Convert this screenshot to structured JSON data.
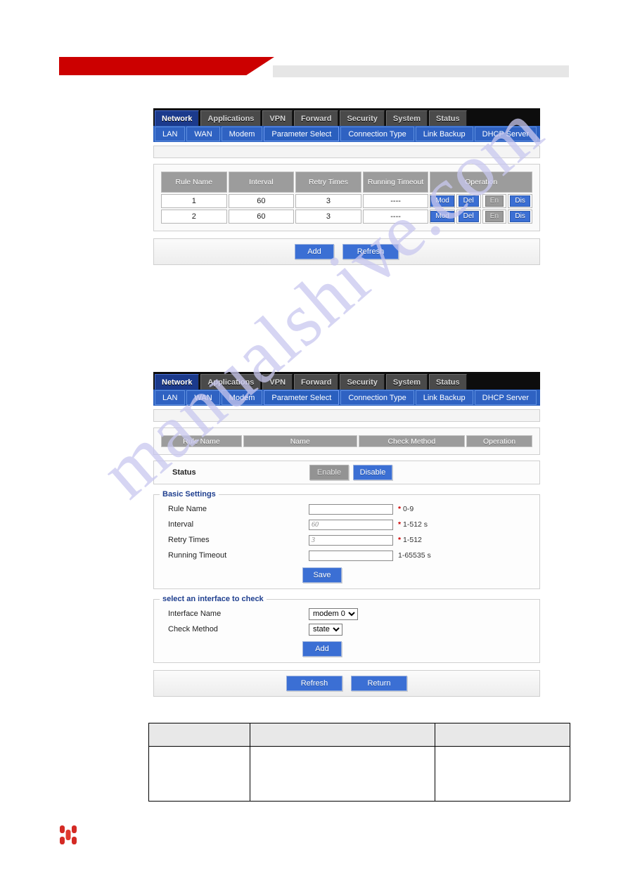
{
  "watermark": {
    "text": "manualshive.com"
  },
  "nav": {
    "main_tabs": [
      {
        "label": "Network",
        "active": true
      },
      {
        "label": "Applications",
        "active": false
      },
      {
        "label": "VPN",
        "active": false
      },
      {
        "label": "Forward",
        "active": false
      },
      {
        "label": "Security",
        "active": false
      },
      {
        "label": "System",
        "active": false
      },
      {
        "label": "Status",
        "active": false
      }
    ],
    "sub_tabs": [
      {
        "label": "LAN",
        "active": false
      },
      {
        "label": "WAN",
        "active": false
      },
      {
        "label": "Modem",
        "active": false
      },
      {
        "label": "Parameter Select",
        "active": true
      },
      {
        "label": "Connection Type",
        "active": false
      },
      {
        "label": "Link Backup",
        "active": false
      },
      {
        "label": "DHCP Server",
        "active": false
      }
    ]
  },
  "panel1": {
    "table": {
      "columns": [
        "Rule Name",
        "Interval",
        "Retry Times",
        "Running Timeout",
        "Operation"
      ],
      "rows": [
        {
          "rule_name": "1",
          "interval": "60",
          "retry_times": "3",
          "running_timeout": "----",
          "operations": [
            {
              "label": "Mod",
              "enabled": true
            },
            {
              "label": "Del",
              "enabled": true
            },
            {
              "label": "En",
              "enabled": false
            },
            {
              "label": "Dis",
              "enabled": true
            }
          ]
        },
        {
          "rule_name": "2",
          "interval": "60",
          "retry_times": "3",
          "running_timeout": "----",
          "operations": [
            {
              "label": "Mod",
              "enabled": true
            },
            {
              "label": "Del",
              "enabled": true
            },
            {
              "label": "En",
              "enabled": false
            },
            {
              "label": "Dis",
              "enabled": true
            }
          ]
        }
      ]
    },
    "buttons": {
      "add": "Add",
      "refresh": "Refresh"
    }
  },
  "panel2": {
    "table": {
      "columns": [
        "Rule Name",
        "Name",
        "Check Method",
        "Operation"
      ]
    },
    "status": {
      "label": "Status",
      "enable": "Enable",
      "disable": "Disable",
      "enable_active": false,
      "disable_active": true
    },
    "basic_settings": {
      "legend": "Basic Settings",
      "fields": [
        {
          "label": "Rule Name",
          "value": "",
          "required": true,
          "hint": "0-9"
        },
        {
          "label": "Interval",
          "value": "60",
          "required": true,
          "hint": "1-512 s"
        },
        {
          "label": "Retry Times",
          "value": "3",
          "required": true,
          "hint": "1-512"
        },
        {
          "label": "Running Timeout",
          "value": "",
          "required": false,
          "hint": "1-65535 s"
        }
      ],
      "save": "Save"
    },
    "interface_check": {
      "legend": "select an interface to check",
      "interface_name_label": "Interface Name",
      "interface_name_value": "modem 0",
      "interface_name_options": [
        "modem 0"
      ],
      "check_method_label": "Check Method",
      "check_method_value": "state",
      "check_method_options": [
        "state"
      ],
      "add": "Add"
    },
    "buttons": {
      "refresh": "Refresh",
      "return": "Return"
    }
  },
  "colors": {
    "accent_blue": "#3b6fd4",
    "nav_black": "#0d0d0d",
    "subnav_blue": "#2a5fbe",
    "brand_red": "#cc0000",
    "required_red": "#cc0000",
    "header_grey": "#9c9c9c"
  }
}
